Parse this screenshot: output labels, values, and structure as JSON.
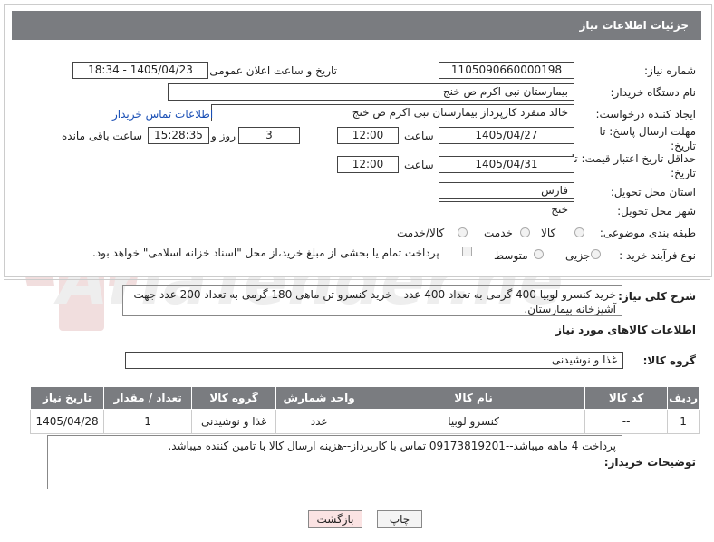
{
  "header": {
    "title": "جزئیات اطلاعات نیاز"
  },
  "fields": {
    "need_number_label": "شماره نیاز:",
    "need_number": "1105090660000198",
    "announce_label": "تاریخ و ساعت اعلان عمومی:",
    "announce_value": "1405/04/23 - 18:34",
    "buyer_org_label": "نام دستگاه خریدار:",
    "buyer_org": "بیمارستان نبی اکرم  ص  خنج",
    "creator_label": "ایجاد کننده درخواست:",
    "creator": "خالد منفرد کارپرداز بیمارستان نبی اکرم  ص  خنج",
    "contact_link": "اطلاعات تماس خریدار",
    "deadline_label": "مهلت ارسال پاسخ: تا تاریخ:",
    "deadline_date": "1405/04/27",
    "time_label": "ساعت",
    "deadline_time": "12:00",
    "days": "3",
    "days_label": "روز و",
    "remaining_time": "15:28:35",
    "remaining_label": "ساعت باقی مانده",
    "price_validity_label": "حداقل تاریخ اعتبار قیمت: تا تاریخ:",
    "price_validity_date": "1405/04/31",
    "price_validity_time": "12:00",
    "province_label": "استان محل تحویل:",
    "province": "فارس",
    "city_label": "شهر محل تحویل:",
    "city": "خنج",
    "category_label": "طبقه بندی موضوعی:",
    "category_options": [
      "کالا",
      "خدمت",
      "کالا/خدمت"
    ],
    "process_label": "نوع فرآیند خرید :",
    "process_options": [
      "جزیی",
      "متوسط"
    ],
    "payment_note": "پرداخت تمام یا بخشی از مبلغ خرید،از محل \"اسناد خزانه اسلامی\" خواهد بود."
  },
  "description": {
    "label": "شرح کلی نیاز:",
    "text": "خرید کنسرو لوبیا 400 گرمی به تعداد 400 عدد---خرید کنسرو تن ماهی 180 گرمی به تعداد  200 عدد جهت آشپزخانه بیمارستان."
  },
  "goods": {
    "section_title": "اطلاعات کالاهای مورد نیاز",
    "group_label": "گروه کالا:",
    "group_value": "غذا و نوشیدنی",
    "columns": [
      "ردیف",
      "کد کالا",
      "نام کالا",
      "واحد شمارش",
      "گروه کالا",
      "تعداد / مقدار",
      "تاریخ نیاز"
    ],
    "rows": [
      [
        "1",
        "--",
        "کنسرو لوبیا",
        "عدد",
        "غذا و نوشیدنی",
        "1",
        "1405/04/28"
      ]
    ]
  },
  "buyer_notes": {
    "label": "توضیحات خریدار:",
    "text": "پرداخت 4 ماهه میباشد--09173819201 تماس با کارپرداز--هزینه ارسال کالا با تامین کننده میباشد."
  },
  "buttons": {
    "print": "چاپ",
    "back": "بازگشت"
  },
  "watermark": {
    "text": "AriaTender.net"
  },
  "colors": {
    "header_bg": "#7a7c80",
    "link": "#1a4fb5",
    "back_btn_bg": "#fbe3e3"
  }
}
